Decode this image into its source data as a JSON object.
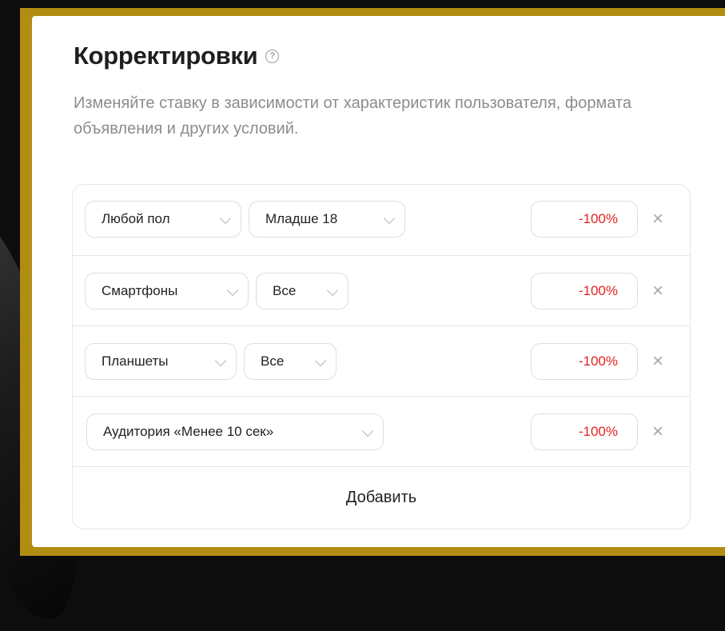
{
  "panel": {
    "title": "Корректировки",
    "help_icon": "?",
    "description": "Изменяйте ставку в зависимости от характеристик пользователя, формата объявления и других условий."
  },
  "rows": [
    {
      "select1": "Любой пол",
      "select2": "Младше 18",
      "value": "-100%",
      "remove": "×"
    },
    {
      "select1": "Смартфоны",
      "select2": "Все",
      "value": "-100%",
      "remove": "×"
    },
    {
      "select1": "Планшеты",
      "select2": "Все",
      "value": "-100%",
      "remove": "×"
    },
    {
      "select1": "Аудитория «Менее 10 сек»",
      "value": "-100%",
      "remove": "×"
    }
  ],
  "add_label": "Добавить",
  "colors": {
    "frame": "#b18d11",
    "negative_value": "#e32222",
    "muted_text": "#8c8c8c"
  }
}
